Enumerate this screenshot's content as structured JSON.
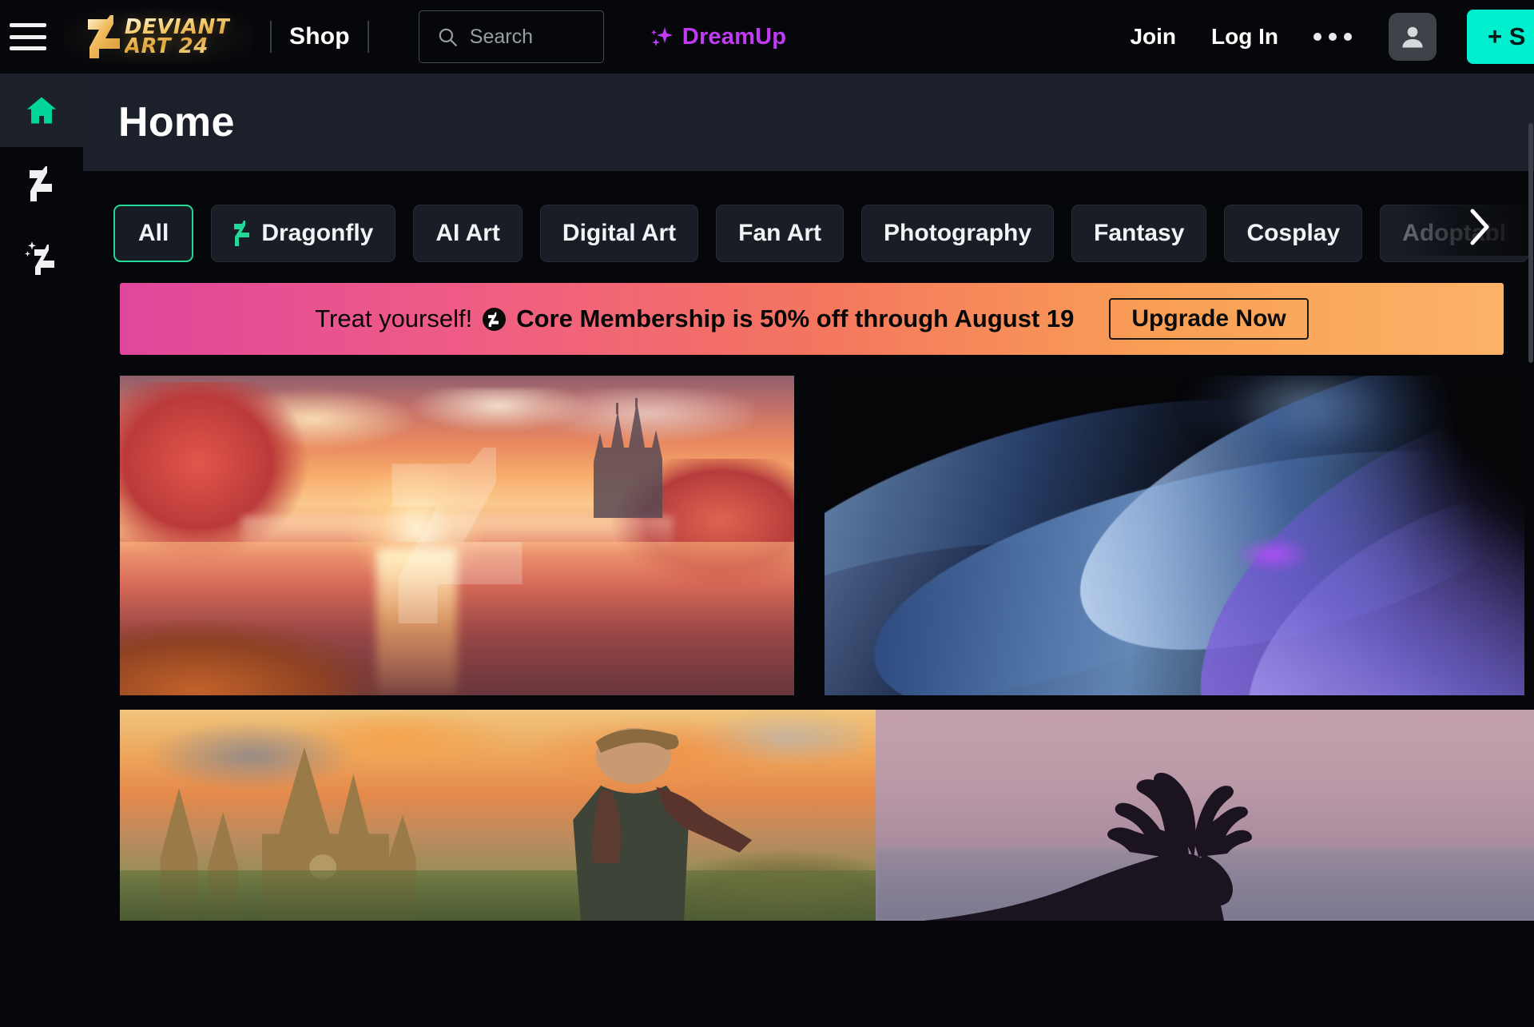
{
  "topbar": {
    "menu_icon": "hamburger-icon",
    "logo": {
      "line1": "DEVIANT",
      "line2": "ART 24",
      "icon": "deviantart-bolt-logo"
    },
    "shop_label": "Shop",
    "search": {
      "placeholder": "Search",
      "icon": "search-icon"
    },
    "dreamup": {
      "label": "DreamUp",
      "icon": "sparkle-icon"
    },
    "join_label": "Join",
    "login_label": "Log In",
    "more_icon": "ellipsis-icon",
    "avatar_icon": "user-avatar-icon",
    "submit_label": "+ S"
  },
  "rail": {
    "items": [
      {
        "icon": "home-icon",
        "name": "home",
        "active": true
      },
      {
        "icon": "lightning-bolt-icon",
        "name": "dragonfly",
        "active": false
      },
      {
        "icon": "sparkle-bolt-icon",
        "name": "dreamup",
        "active": false
      }
    ]
  },
  "page": {
    "title": "Home"
  },
  "filters": {
    "scroll_next_icon": "chevron-right-icon",
    "chips": [
      {
        "label": "All",
        "selected": true,
        "icon": null,
        "faded": false
      },
      {
        "label": "Dragonfly",
        "selected": false,
        "icon": "green-bolt-icon",
        "faded": false
      },
      {
        "label": "AI Art",
        "selected": false,
        "icon": null,
        "faded": false
      },
      {
        "label": "Digital Art",
        "selected": false,
        "icon": null,
        "faded": false
      },
      {
        "label": "Fan Art",
        "selected": false,
        "icon": null,
        "faded": false
      },
      {
        "label": "Photography",
        "selected": false,
        "icon": null,
        "faded": false
      },
      {
        "label": "Fantasy",
        "selected": false,
        "icon": null,
        "faded": false
      },
      {
        "label": "Cosplay",
        "selected": false,
        "icon": null,
        "faded": false
      },
      {
        "label": "Adoptabl",
        "selected": false,
        "icon": null,
        "faded": true
      }
    ]
  },
  "banner": {
    "pre_text": "Treat yourself! ",
    "badge_icon": "core-membership-icon",
    "strong_text": "Core Membership is 50% off through August 19",
    "cta_label": "Upgrade Now",
    "gradient_from": "#e0479c",
    "gradient_to": "#fbb267"
  },
  "grid": {
    "tiles": [
      {
        "name": "artwork-sunset-lake-castle",
        "alt": "Fantasy sunset lake with red autumn trees and distant castle",
        "watermark": "deviantart-watermark"
      },
      {
        "name": "artwork-abstract-blue-purple-waves",
        "alt": "Abstract flowing blue and purple waves on dark background"
      },
      {
        "name": "artwork-castle-character-sunset",
        "alt": "Fantasy character in cloak before gothic castle at orange sunset"
      },
      {
        "name": "artwork-deer-silhouette-dusk",
        "alt": "Silhouette of antlered deer against dusk purple sky"
      }
    ]
  },
  "colors": {
    "accent_green": "#22d99a",
    "submit_cyan": "#00f0cf",
    "dreamup_purple": "#c13bf5",
    "page_bg": "#06070a",
    "header_bg": "#1b202a",
    "chip_bg": "#181d26"
  }
}
